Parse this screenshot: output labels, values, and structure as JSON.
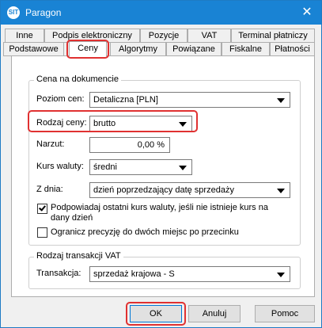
{
  "window": {
    "app_icon_text": "SIT",
    "title": "Paragon",
    "close_glyph": "✕"
  },
  "tabs_row1": [
    "Inne",
    "Podpis elektroniczny",
    "Pozycje",
    "VAT",
    "Terminal płatniczy"
  ],
  "tabs_row2": [
    "Podstawowe",
    "Ceny",
    "Algorytmy",
    "Powiązane",
    "Fiskalne",
    "Płatności"
  ],
  "active_tab": "Ceny",
  "price_group": {
    "title": "Cena na dokumencie",
    "poziom_cen": {
      "label": "Poziom cen:",
      "value": "Detaliczna [PLN]"
    },
    "rodzaj_ceny": {
      "label": "Rodzaj ceny:",
      "value": "brutto"
    },
    "narzut": {
      "label": "Narzut:",
      "value": "0,00 %"
    },
    "kurs_waluty": {
      "label": "Kurs waluty:",
      "value": "średni"
    },
    "z_dnia": {
      "label": "Z dnia:",
      "value": "dzień poprzedzający datę sprzedaży"
    },
    "checkbox_podpowiadaj": {
      "label_line1": "Podpowiadaj ostatni kurs waluty, jeśli nie istnieje kurs na",
      "label_line2": "dany dzień",
      "checked": true
    },
    "checkbox_ogranicz": {
      "label": "Ogranicz precyzję do dwóch miejsc po przecinku",
      "checked": false
    }
  },
  "vat_group": {
    "title": "Rodzaj transakcji VAT",
    "transakcja": {
      "label": "Transakcja:",
      "value": "sprzedaż krajowa - S"
    }
  },
  "buttons": {
    "ok": "OK",
    "cancel": "Anuluj",
    "help": "Pomoc"
  },
  "colors": {
    "titlebar": "#1983d4",
    "highlight": "#e03131"
  }
}
